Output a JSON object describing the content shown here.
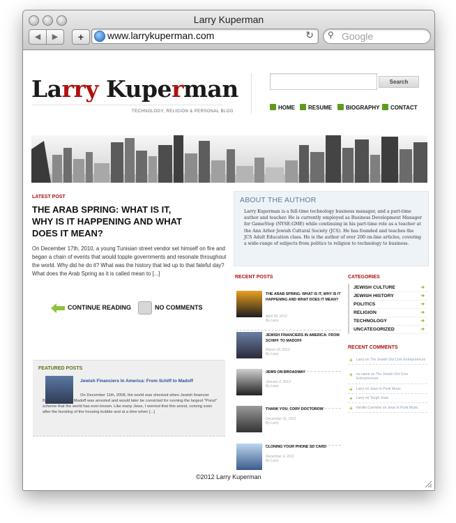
{
  "window": {
    "title": "Larry Kuperman",
    "back": "◀",
    "forward": "▶",
    "add": "+",
    "url": "www.larrykuperman.com",
    "reload": "↻",
    "search_placeholder": "Google"
  },
  "site": {
    "logo": {
      "part1": "La",
      "part2": "rry",
      "part3": " Kupe",
      "part4": "r",
      "part5": "man"
    },
    "tagline": "TECHNOLOGY, RELIGION & PERSONAL BLOG",
    "search_button": "Search",
    "menu": [
      "HOME",
      "RESUME",
      "BIOGRAPHY",
      "CONTACT"
    ]
  },
  "latest_post": {
    "label": "LATEST POST",
    "title": "THE ARAB SPRING: WHAT IS IT, WHY IS IT HAPPENING AND WHAT DOES IT MEAN?",
    "body": "On December 17th, 2010, a young Tunisian street vendor set himself on fire and began a chain of events that would topple governments and resonate throughout the world. Why did he do it? What was the history that led up to that fateful day? What does the Arab Spring as it is called mean to [...]",
    "continue": "CONTINUE READING",
    "comments": "NO COMMENTS"
  },
  "featured": {
    "label": "FEATURED POSTS",
    "title": "Jewish Financiers In America: From Schiff to Madoff",
    "body": "On December 11th, 2008, the world was shocked when Jewish financier Bernard \"Bernie\" Madoff was arrested and would later be convicted for running the largest \"Ponzi\" scheme that the world has ever known. Like many Jews, I worried that this arrest, coming soon after the bursting of the housing bubble and at a time when [...]"
  },
  "about": {
    "title": "ABOUT THE AUTHOR",
    "body": "Larry Kuperman is a full-time technology business manager, and a part-time author and teacher. He is currently employed as Business Development Manager for GameStop (NYSE:GME) while continuing in his part-time role as a teacher at the Ann Arbor Jewish Cultural Society (JCS). He has founded and teaches the JCS Adult Education class. He is the author of over 200 on-line articles, covering a wide-range of subjects from politics to religion to technology to business."
  },
  "recent_posts": {
    "label": "RECENT POSTS",
    "items": [
      {
        "title": "THE ARAB SPRING: WHAT IS IT, WHY IS IT HAPPENING AND WHAT DOES IT MEAN?",
        "date": "April 30, 2012",
        "by": "By Larry"
      },
      {
        "title": "JEWISH FINANCIERS IN AMERICA: FROM SCHIFF TO MADOFF",
        "date": "March 18, 2012",
        "by": "By Larry"
      },
      {
        "title": "JEWS ON BROADWAY",
        "date": "January 2, 2012",
        "by": "By Larry"
      },
      {
        "title": "THANK YOU, CORY DOCTOROW",
        "date": "December 31, 2011",
        "by": "By Larry"
      },
      {
        "title": "CLONING YOUR PHONE SD CARD",
        "date": "December 4, 2011",
        "by": "By Larry"
      }
    ]
  },
  "categories": {
    "label": "CATEGORIES",
    "items": [
      "JEWISH CULTURE",
      "JEWISH HISTORY",
      "POLITICS",
      "RELIGION",
      "TECHNOLOGY",
      "UNCATEGORIZED"
    ],
    "arrow": "➜"
  },
  "recent_comments": {
    "label": "RECENT COMMENTS",
    "items": [
      {
        "author": "Larry",
        "on": " on ",
        "post": "The Jewish Dot Com Entrepreneurs"
      },
      {
        "author": "no name",
        "on": " on ",
        "post": "The Jewish Dot Com Entrepreneurs"
      },
      {
        "author": "Larry",
        "on": " on ",
        "post": "Jews In Punk Music"
      },
      {
        "author": "Larry",
        "on": " on ",
        "post": "Tough Jews"
      },
      {
        "author": "Neville Carmelin",
        "on": " on ",
        "post": "Jews In Punk Music"
      }
    ]
  },
  "footer": "©2012 Larry Kuperman"
}
